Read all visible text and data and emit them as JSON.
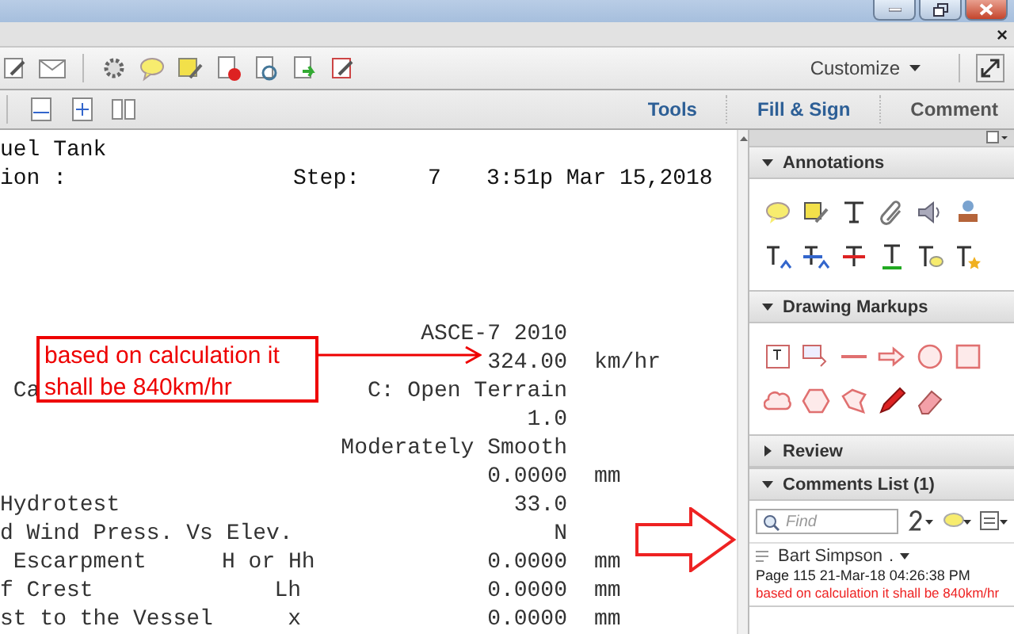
{
  "menu_bar": {
    "close": "×"
  },
  "toolbar": {
    "customize": "Customize"
  },
  "tabs": [
    {
      "label": "Tools",
      "selected": false
    },
    {
      "label": "Fill & Sign",
      "selected": false
    },
    {
      "label": "Comment",
      "selected": true
    }
  ],
  "document": {
    "header_lines": [
      [
        "uel Tank"
      ],
      [
        "ion :",
        "Step:",
        "7",
        "3:51p Mar 15,2018"
      ]
    ],
    "rows": [
      {
        "label": "",
        "symbol": "",
        "value": "ASCE-7 2010",
        "unit": ""
      },
      {
        "label": "",
        "symbol": "",
        "value": "324.00",
        "unit": "km/hr"
      },
      {
        "label": " Ca",
        "symbol": "",
        "value": "C: Open Terrain",
        "unit": ""
      },
      {
        "label": "",
        "symbol": "",
        "value": "1.0",
        "unit": ""
      },
      {
        "label": "",
        "symbol": "",
        "value": "Moderately Smooth",
        "unit": ""
      },
      {
        "label": "",
        "symbol": "",
        "value": "0.0000",
        "unit": "mm"
      },
      {
        "label": "Hydrotest",
        "symbol": "",
        "value": "33.0",
        "unit": ""
      },
      {
        "label": "d Wind Press. Vs Elev.",
        "symbol": "",
        "value": "N",
        "unit": ""
      },
      {
        "label": " Escarpment",
        "symbol": "H or Hh",
        "value": "0.0000",
        "unit": "mm"
      },
      {
        "label": "f Crest",
        "symbol": "Lh",
        "value": "0.0000",
        "unit": "mm"
      },
      {
        "label": "st to the Vessel",
        "symbol": "x",
        "value": "0.0000",
        "unit": "mm"
      }
    ],
    "callout": "based on calculation it shall be 840km/hr"
  },
  "panel": {
    "sections": [
      {
        "kind": "annotations",
        "title": "Annotations",
        "expanded": true
      },
      {
        "kind": "markups",
        "title": "Drawing Markups",
        "expanded": true
      },
      {
        "kind": "review",
        "title": "Review",
        "expanded": false
      },
      {
        "kind": "comments",
        "title": "Comments List (1)",
        "expanded": true
      }
    ],
    "find": {
      "placeholder": "Find"
    },
    "comment": {
      "author": "Bart Simpson",
      "status": ".",
      "meta": "Page 115  21-Mar-18 04:26:38 PM",
      "text": "based on calculation it shall be 840km/hr"
    }
  }
}
